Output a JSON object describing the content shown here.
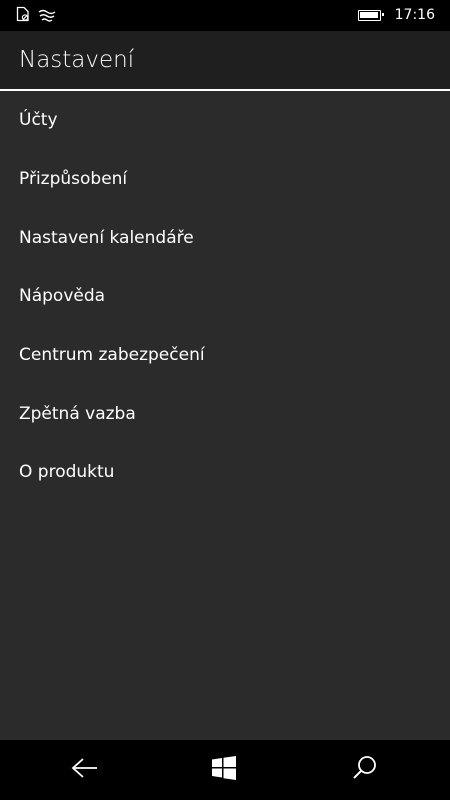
{
  "status_bar": {
    "time": "17:16",
    "icons": [
      "mobile-data-icon",
      "wifi-signal-icon",
      "battery-icon"
    ],
    "battery_level": 1.0
  },
  "header": {
    "title": "Nastavení"
  },
  "settings": {
    "items": [
      {
        "label": "Účty"
      },
      {
        "label": "Přizpůsobení"
      },
      {
        "label": "Nastavení kalendáře"
      },
      {
        "label": "Nápověda"
      },
      {
        "label": "Centrum zabezpečení"
      },
      {
        "label": "Zpětná vazba"
      },
      {
        "label": "O produktu"
      }
    ]
  },
  "nav_bar": {
    "buttons": [
      "back-icon",
      "windows-logo-icon",
      "search-icon"
    ]
  },
  "colors": {
    "background": "#2b2b2b",
    "header_background": "#1f1f1f",
    "status_bar": "#000000",
    "nav_bar": "#000000",
    "text": "#ffffff"
  }
}
